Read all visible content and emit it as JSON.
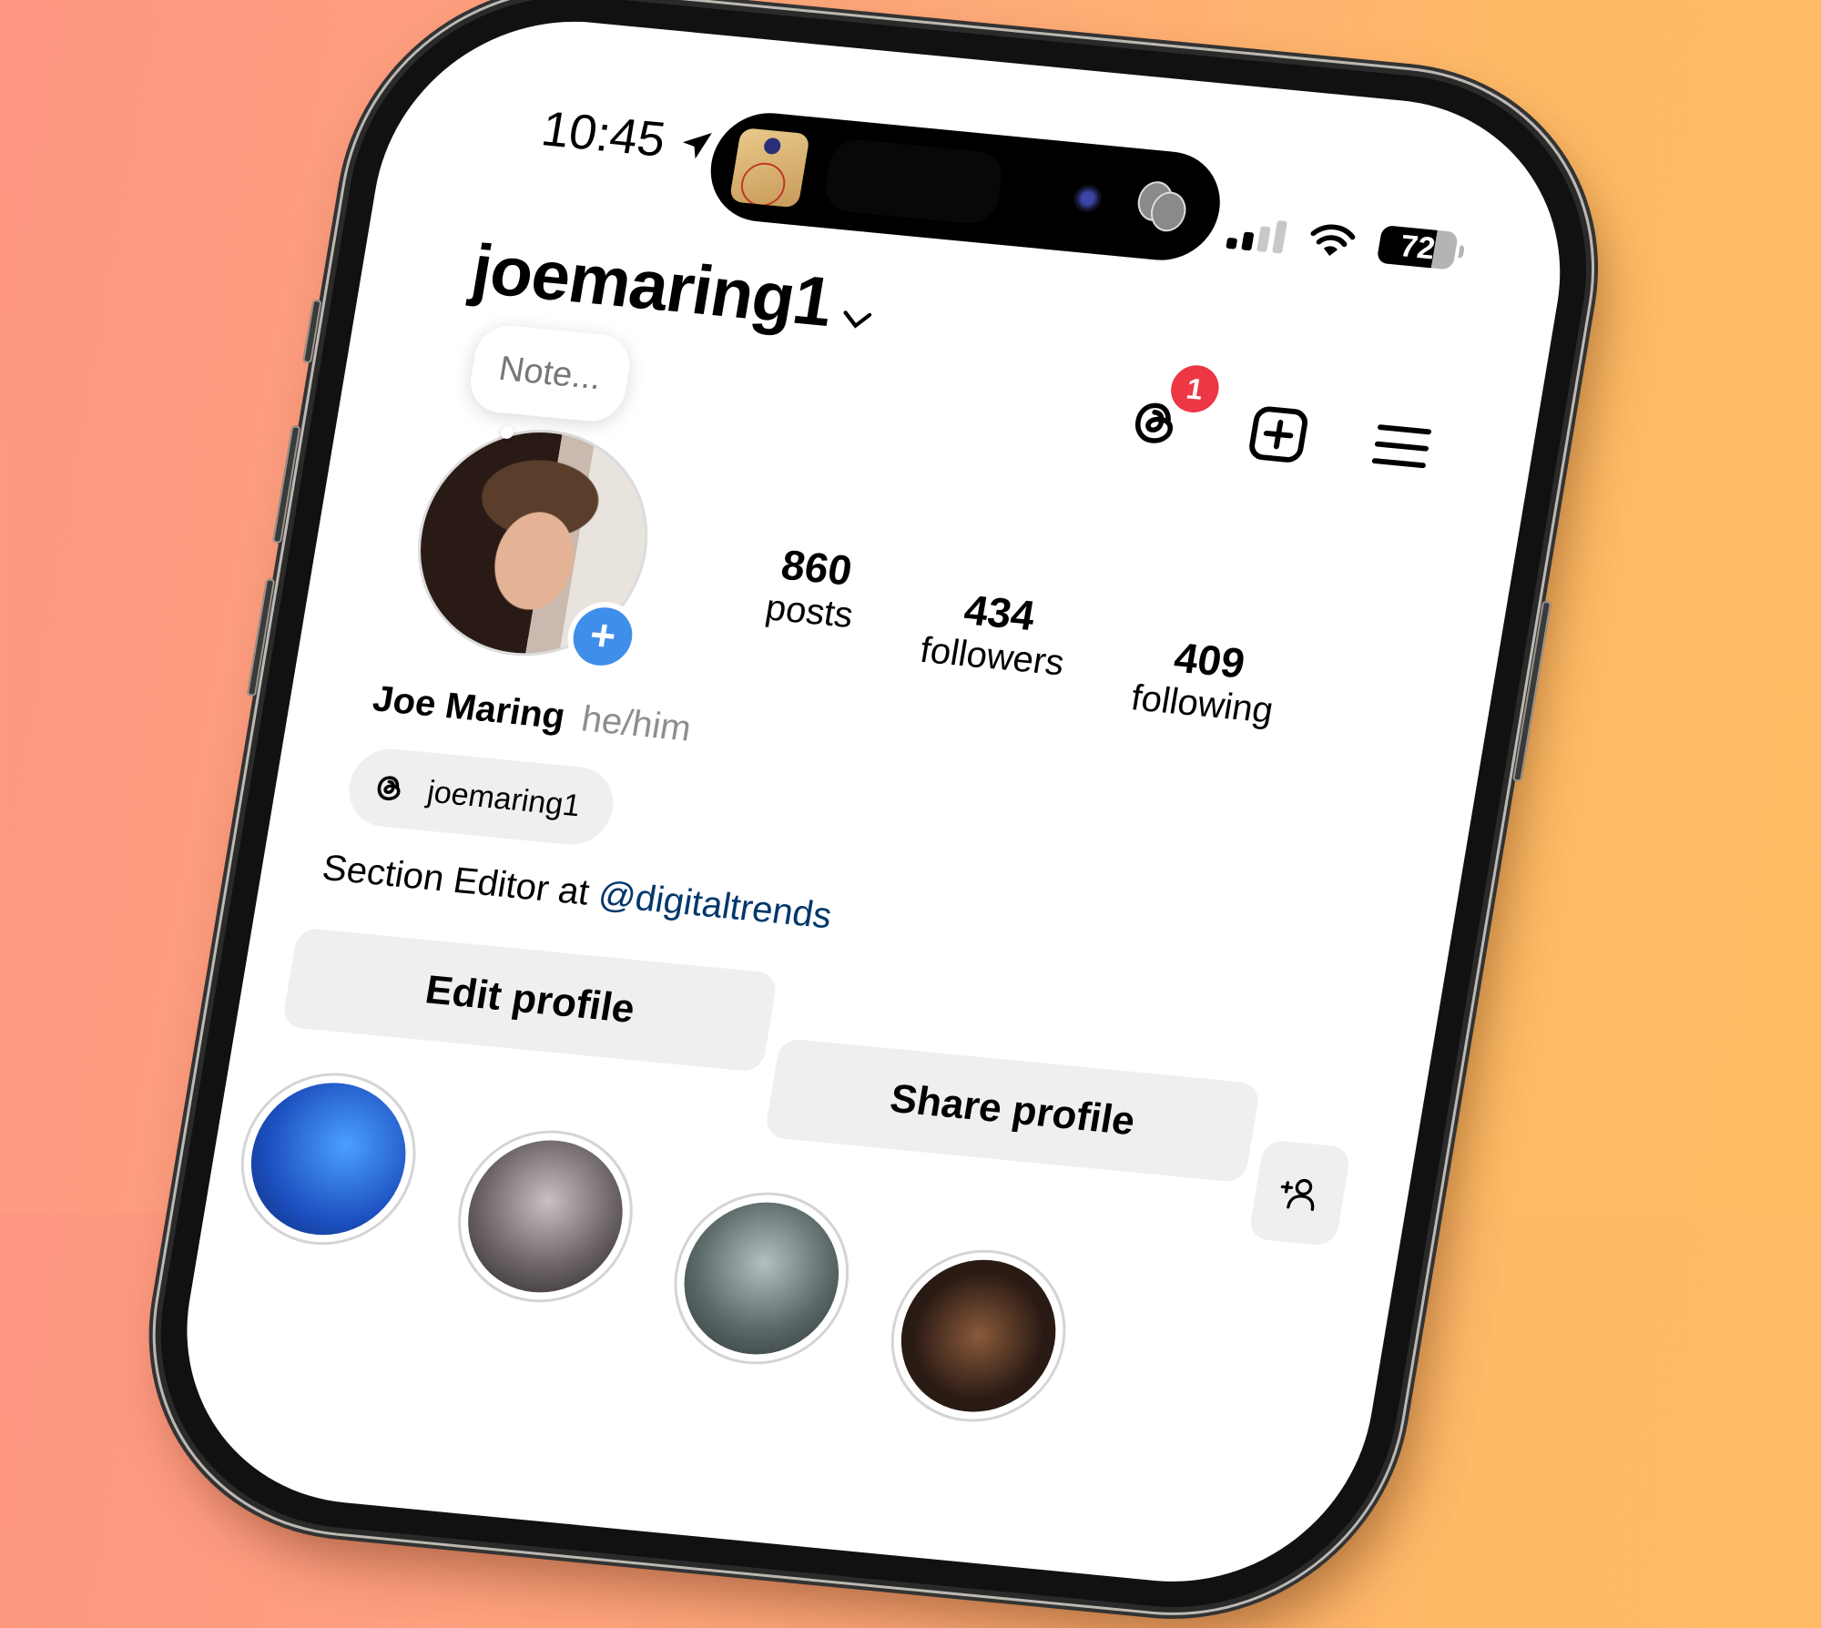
{
  "status_bar": {
    "time": "10:45",
    "location_icon": "location-arrow-icon",
    "signal_bars_active": 2,
    "signal_bars_total": 4,
    "wifi_icon": "wifi-icon",
    "battery_percent": "72"
  },
  "header": {
    "username": "joemaring1",
    "account_switcher_icon": "chevron-down-icon",
    "threads_badge_count": "1",
    "icons": [
      "threads-icon",
      "create-plus-icon",
      "menu-hamburger-icon"
    ]
  },
  "profile": {
    "note_placeholder": "Note...",
    "add_story_label": "+",
    "stats": [
      {
        "value": "860",
        "label": "posts"
      },
      {
        "value": "434",
        "label": "followers"
      },
      {
        "value": "409",
        "label": "following"
      }
    ],
    "display_name": "Joe Maring",
    "pronouns": "he/him",
    "threads_handle": "joemaring1",
    "bio_text": "Section Editor at ",
    "bio_link": "@digitaltrends"
  },
  "actions": {
    "edit_profile": "Edit profile",
    "share_profile": "Share profile",
    "discover_people_icon": "add-person-icon"
  },
  "highlights": [
    {
      "name": "highlight-1",
      "color": "#2a6fd6"
    },
    {
      "name": "highlight-2",
      "color": "#6c6466"
    },
    {
      "name": "highlight-3",
      "color": "#5c6a6a"
    },
    {
      "name": "highlight-4",
      "color": "#2a1a14"
    }
  ],
  "colors": {
    "badge": "#ed3744",
    "add_story": "#3f8ee9",
    "link": "#00376b",
    "button_bg": "#efefef",
    "bg_left": "#fd9682",
    "bg_right": "#ffbd63"
  }
}
